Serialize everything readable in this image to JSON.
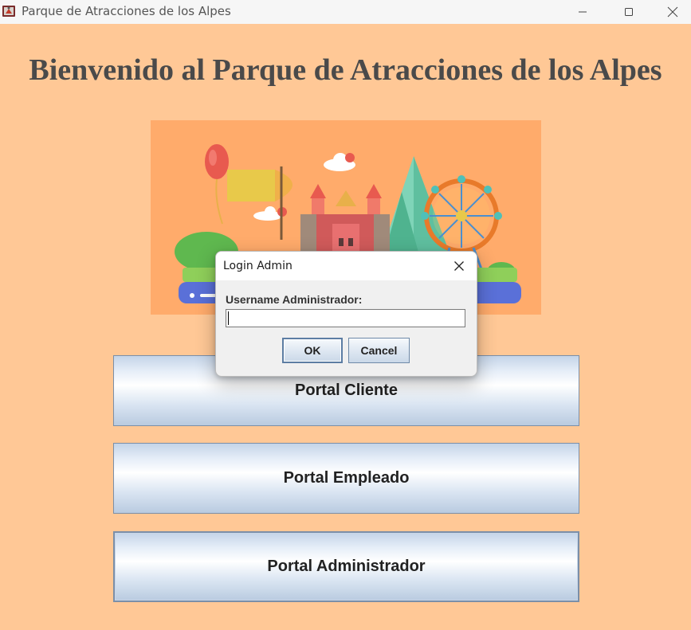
{
  "window": {
    "title": "Parque de Atracciones de los Alpes",
    "app_icon": "java-cup-icon",
    "controls": [
      "minimize-icon",
      "maximize-icon",
      "close-icon"
    ]
  },
  "main": {
    "heading": "Bienvenido al Parque de Atracciones de los Alpes",
    "banner_image": "amusement-park-illustration",
    "buttons": {
      "cliente": "Portal Cliente",
      "empleado": "Portal Empleado",
      "admin": "Portal Administrador"
    }
  },
  "dialog": {
    "title": "Login Admin",
    "label": "Username Administrador:",
    "input_value": "",
    "ok_label": "OK",
    "cancel_label": "Cancel"
  },
  "colors": {
    "background": "#ffc896",
    "banner_bg": "#ffab6b",
    "heading_text": "#4a4a4a"
  }
}
